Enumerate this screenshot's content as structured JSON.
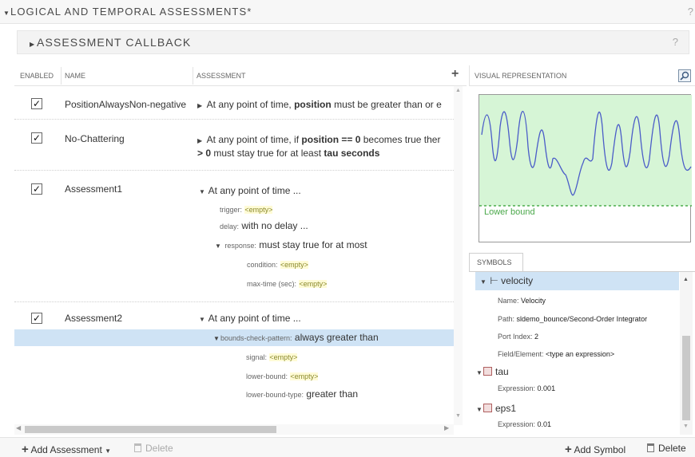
{
  "panel": {
    "title": "LOGICAL AND TEMPORAL ASSESSMENTS*",
    "help": "?",
    "callback_title": "ASSESSMENT CALLBACK",
    "callback_help": "?"
  },
  "table": {
    "headers": [
      "ENABLED",
      "NAME",
      "ASSESSMENT"
    ],
    "add_icon": "plus-icon",
    "rows": [
      {
        "enabled": true,
        "name": "PositionAlwaysNon-negative",
        "line1_a": "At any point of time, ",
        "line1_b": "position",
        "line1_c": " must be greater than or e"
      },
      {
        "enabled": true,
        "name": "No-Chattering",
        "line1_a": "At any point of time, if ",
        "line1_b": "position == 0",
        "line1_c": " becomes true ther",
        "line2_a": "> 0",
        "line2_b": " must stay true for at least ",
        "line2_c": "tau seconds"
      },
      {
        "enabled": true,
        "name": "Assessment1",
        "head": "At any point of time ...",
        "trigger_label": "trigger:",
        "trigger_value": "<empty>",
        "delay_label": "delay:",
        "delay_value": "with no delay ...",
        "response_label": "response:",
        "response_value": "must stay true for at most",
        "condition_label": "condition:",
        "condition_value": "<empty>",
        "maxtime_label": "max-time (sec):",
        "maxtime_value": "<empty>"
      },
      {
        "enabled": true,
        "name": "Assessment2",
        "head": "At any point of time ...",
        "pattern_label": "bounds-check-pattern:",
        "pattern_value": "always greater than",
        "signal_label": "signal:",
        "signal_value": "<empty>",
        "lb_label": "lower-bound:",
        "lb_value": "<empty>",
        "lbtype_label": "lower-bound-type:",
        "lbtype_value": "greater than"
      }
    ]
  },
  "visual": {
    "title": "VISUAL REPRESENTATION",
    "zoom_icon": "zoom-icon",
    "lower_bound_label": "Lower bound",
    "fill_color": "#d6f5d6",
    "line_color": "#4a5cc8",
    "bound_color": "#2e9e2e"
  },
  "symbols": {
    "tab": "SYMBOLS",
    "velocity": {
      "name": "velocity",
      "name_label": "Name:",
      "name_value": "Velocity",
      "path_label": "Path:",
      "path_value": "sldemo_bounce/Second-Order Integrator",
      "port_label": "Port Index:",
      "port_value": "2",
      "field_label": "Field/Element:",
      "field_value": "<type an expression>"
    },
    "tau": {
      "name": "tau",
      "expr_label": "Expression:",
      "expr_value": "0.001"
    },
    "eps1": {
      "name": "eps1",
      "expr_label": "Expression:",
      "expr_value": "0.01"
    }
  },
  "toolbar": {
    "add_assessment": "Add Assessment",
    "delete_left": "Delete",
    "add_symbol": "Add Symbol",
    "delete_right": "Delete"
  }
}
